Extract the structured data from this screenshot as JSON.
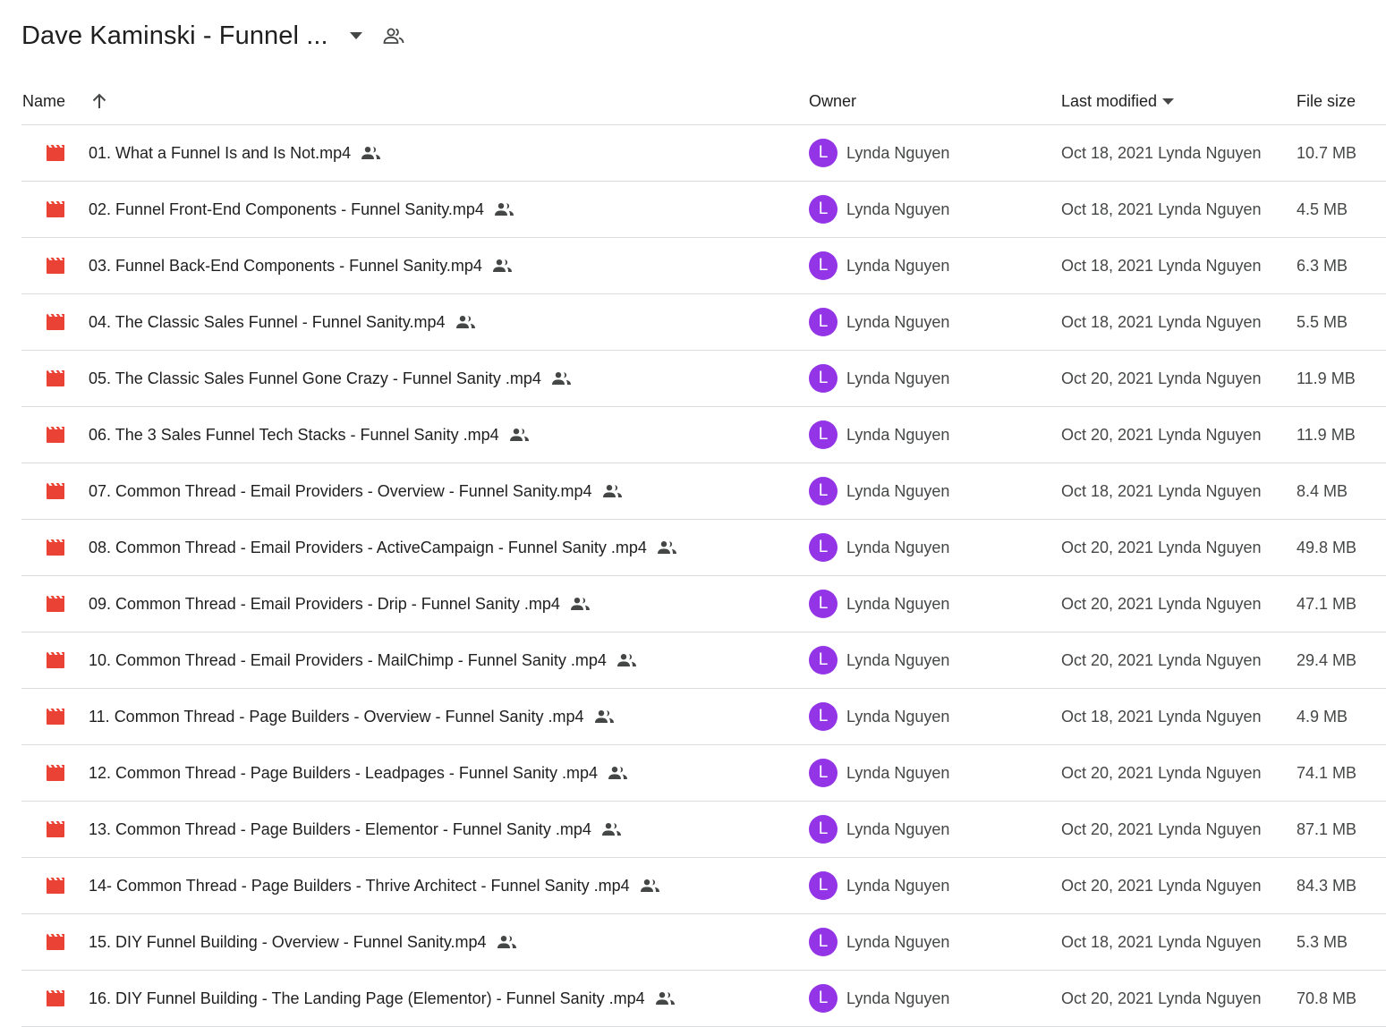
{
  "header": {
    "title": "Dave Kaminski - Funnel ..."
  },
  "columns": {
    "name": "Name",
    "owner": "Owner",
    "last_modified": "Last modified",
    "file_size": "File size"
  },
  "colors": {
    "video_icon": "#ea4335",
    "avatar": "#9334e6"
  },
  "files": [
    {
      "name": "01. What a Funnel Is and Is Not.mp4",
      "owner_initial": "L",
      "owner": "Lynda Nguyen",
      "modified": "Oct 18, 2021 Lynda Nguyen",
      "size": "10.7 MB"
    },
    {
      "name": "02. Funnel Front-End Components - Funnel Sanity.mp4",
      "owner_initial": "L",
      "owner": "Lynda Nguyen",
      "modified": "Oct 18, 2021 Lynda Nguyen",
      "size": "4.5 MB"
    },
    {
      "name": "03. Funnel Back-End Components - Funnel Sanity.mp4",
      "owner_initial": "L",
      "owner": "Lynda Nguyen",
      "modified": "Oct 18, 2021 Lynda Nguyen",
      "size": "6.3 MB"
    },
    {
      "name": "04. The Classic Sales Funnel - Funnel Sanity.mp4",
      "owner_initial": "L",
      "owner": "Lynda Nguyen",
      "modified": "Oct 18, 2021 Lynda Nguyen",
      "size": "5.5 MB"
    },
    {
      "name": "05. The Classic Sales Funnel Gone Crazy - Funnel Sanity .mp4",
      "owner_initial": "L",
      "owner": "Lynda Nguyen",
      "modified": "Oct 20, 2021 Lynda Nguyen",
      "size": "11.9 MB"
    },
    {
      "name": "06. The 3 Sales Funnel Tech Stacks - Funnel Sanity .mp4",
      "owner_initial": "L",
      "owner": "Lynda Nguyen",
      "modified": "Oct 20, 2021 Lynda Nguyen",
      "size": "11.9 MB"
    },
    {
      "name": "07. Common Thread - Email Providers - Overview - Funnel Sanity.mp4",
      "owner_initial": "L",
      "owner": "Lynda Nguyen",
      "modified": "Oct 18, 2021 Lynda Nguyen",
      "size": "8.4 MB"
    },
    {
      "name": "08. Common Thread - Email Providers - ActiveCampaign - Funnel Sanity .mp4",
      "owner_initial": "L",
      "owner": "Lynda Nguyen",
      "modified": "Oct 20, 2021 Lynda Nguyen",
      "size": "49.8 MB"
    },
    {
      "name": "09. Common Thread - Email Providers - Drip - Funnel Sanity .mp4",
      "owner_initial": "L",
      "owner": "Lynda Nguyen",
      "modified": "Oct 20, 2021 Lynda Nguyen",
      "size": "47.1 MB"
    },
    {
      "name": "10. Common Thread - Email Providers - MailChimp - Funnel Sanity .mp4",
      "owner_initial": "L",
      "owner": "Lynda Nguyen",
      "modified": "Oct 20, 2021 Lynda Nguyen",
      "size": "29.4 MB"
    },
    {
      "name": "11. Common Thread - Page Builders - Overview - Funnel Sanity  .mp4",
      "owner_initial": "L",
      "owner": "Lynda Nguyen",
      "modified": "Oct 18, 2021 Lynda Nguyen",
      "size": "4.9 MB"
    },
    {
      "name": "12. Common Thread - Page Builders - Leadpages - Funnel Sanity .mp4",
      "owner_initial": "L",
      "owner": "Lynda Nguyen",
      "modified": "Oct 20, 2021 Lynda Nguyen",
      "size": "74.1 MB"
    },
    {
      "name": "13. Common Thread - Page Builders - Elementor - Funnel Sanity .mp4",
      "owner_initial": "L",
      "owner": "Lynda Nguyen",
      "modified": "Oct 20, 2021 Lynda Nguyen",
      "size": "87.1 MB"
    },
    {
      "name": "14- Common Thread - Page Builders - Thrive Architect - Funnel Sanity .mp4",
      "owner_initial": "L",
      "owner": "Lynda Nguyen",
      "modified": "Oct 20, 2021 Lynda Nguyen",
      "size": "84.3 MB"
    },
    {
      "name": "15. DIY Funnel Building - Overview - Funnel Sanity.mp4",
      "owner_initial": "L",
      "owner": "Lynda Nguyen",
      "modified": "Oct 18, 2021 Lynda Nguyen",
      "size": "5.3 MB"
    },
    {
      "name": "16. DIY Funnel Building - The Landing Page (Elementor) - Funnel Sanity .mp4",
      "owner_initial": "L",
      "owner": "Lynda Nguyen",
      "modified": "Oct 20, 2021 Lynda Nguyen",
      "size": "70.8 MB"
    }
  ]
}
